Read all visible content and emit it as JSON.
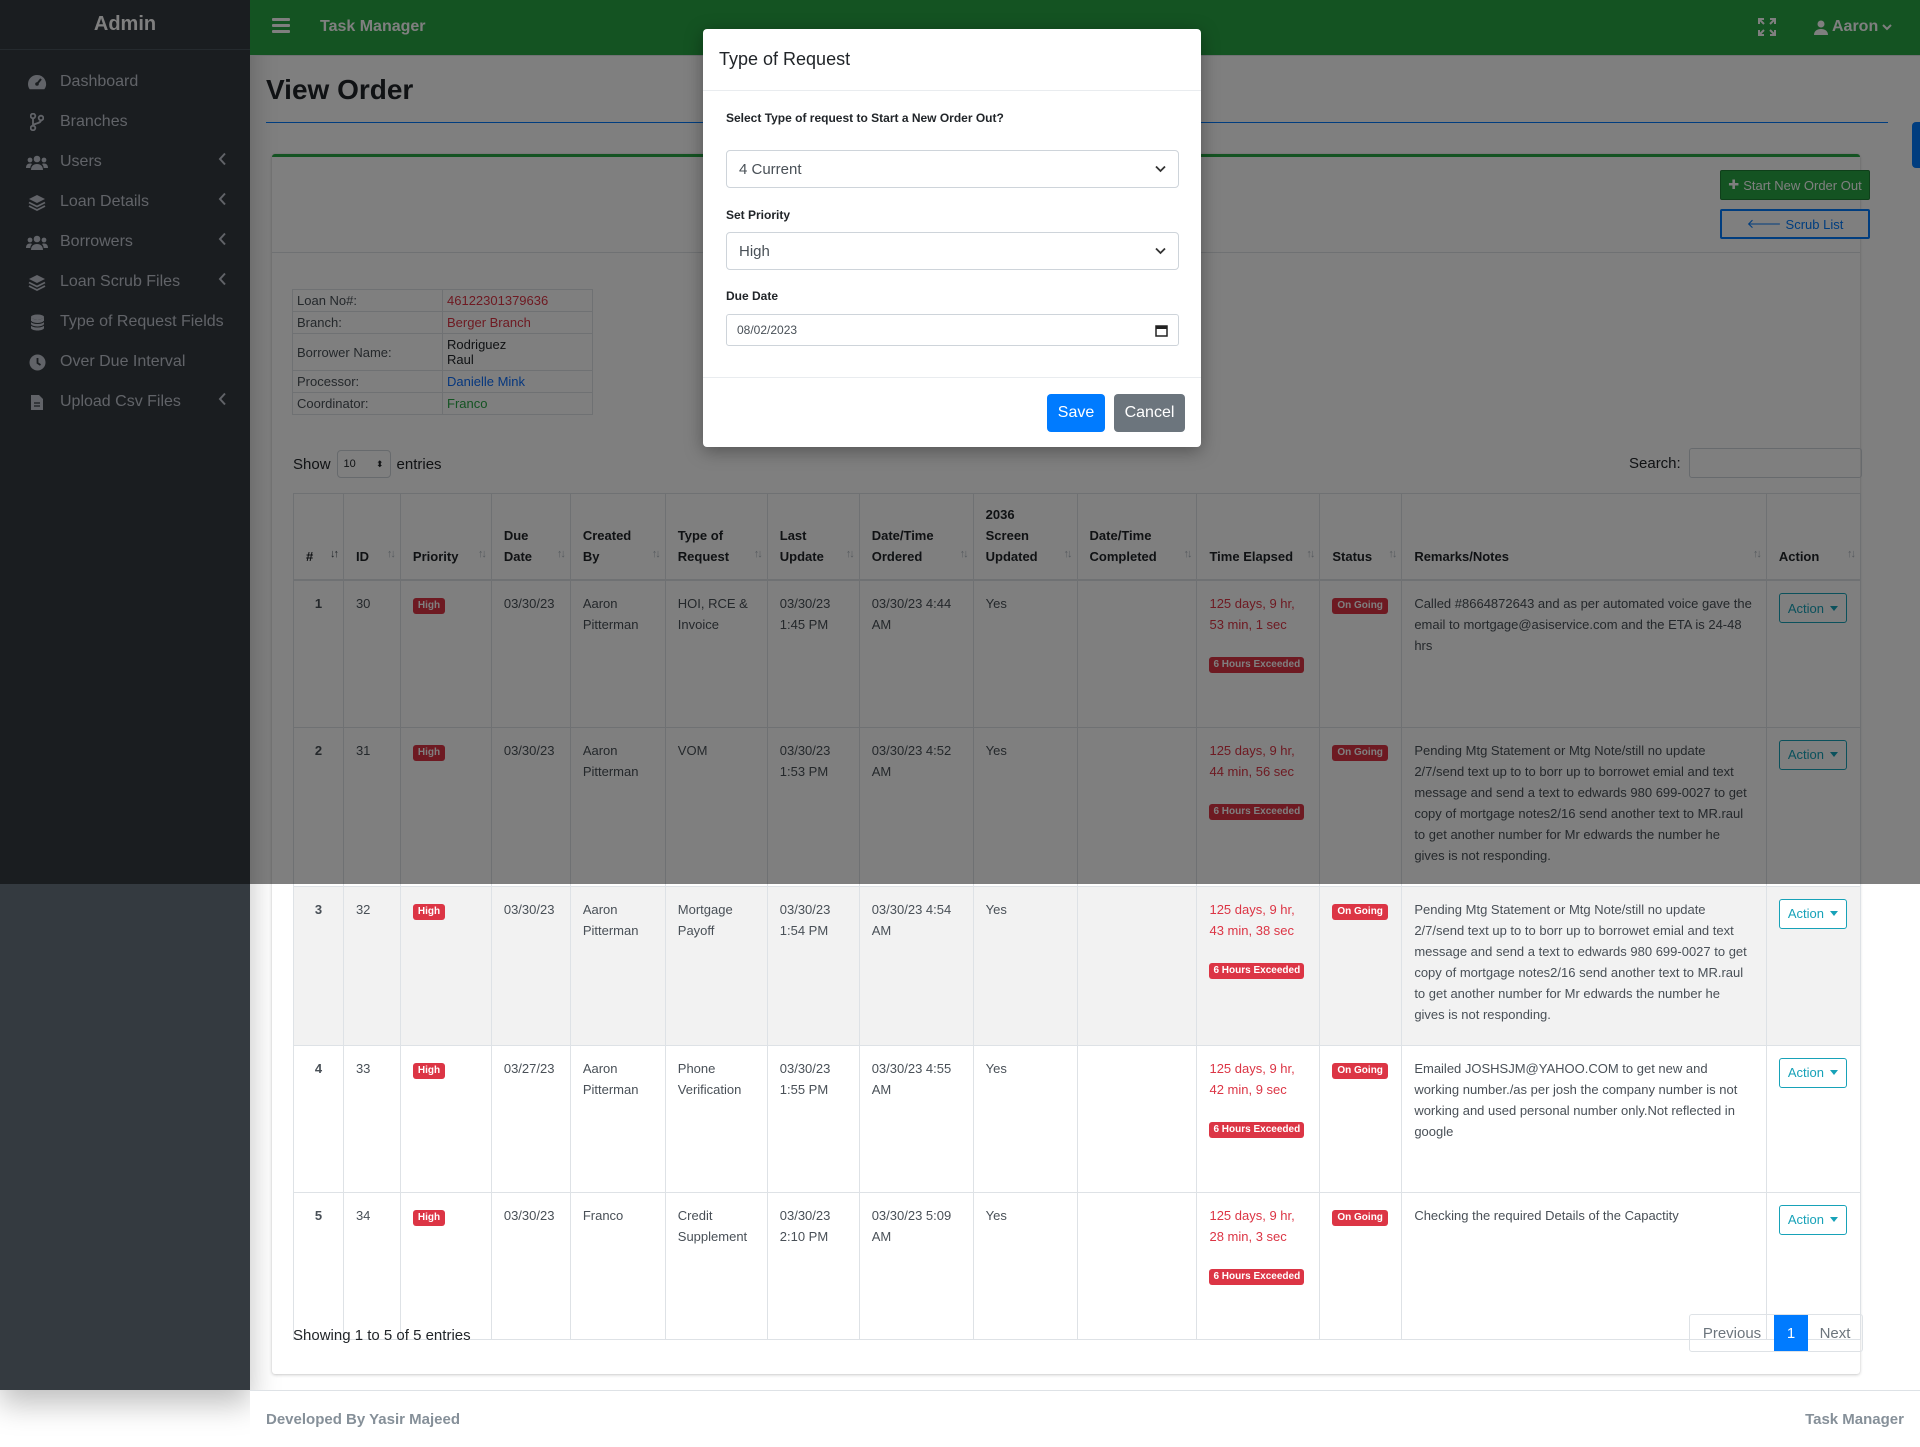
{
  "sidebar": {
    "brand": "Admin",
    "items": [
      {
        "label": "Dashboard",
        "icon": "tachometer-icon",
        "has_arrow": false
      },
      {
        "label": "Branches",
        "icon": "code-branch-icon",
        "has_arrow": false
      },
      {
        "label": "Users",
        "icon": "users-icon",
        "has_arrow": true
      },
      {
        "label": "Loan Details",
        "icon": "layers-icon",
        "has_arrow": true
      },
      {
        "label": "Borrowers",
        "icon": "users-icon",
        "has_arrow": true
      },
      {
        "label": "Loan Scrub Files",
        "icon": "layers-icon",
        "has_arrow": true
      },
      {
        "label": "Type of Request Fields",
        "icon": "database-icon",
        "has_arrow": false
      },
      {
        "label": "Over Due Interval",
        "icon": "clock-icon",
        "has_arrow": false
      },
      {
        "label": "Upload Csv Files",
        "icon": "file-icon",
        "has_arrow": true
      }
    ]
  },
  "topbar": {
    "title": "Task Manager",
    "user": "Aaron"
  },
  "page": {
    "title": "View Order"
  },
  "buttons": {
    "start_new": "Start New Order Out",
    "scrub_list": "Scrub List"
  },
  "info": {
    "loan_no_label": "Loan No#:",
    "loan_no": "46122301379636",
    "branch_label": "Branch:",
    "branch": "Berger Branch",
    "borrower_label": "Borrower Name:",
    "borrower_first": "Rodriguez",
    "borrower_last": "Raul",
    "processor_label": "Processor:",
    "processor": "Danielle Mink",
    "coordinator_label": "Coordinator:",
    "coordinator": "Franco"
  },
  "table_controls": {
    "show": "Show",
    "entries_value": "10",
    "entries": "entries",
    "search_label": "Search:"
  },
  "table": {
    "headers": [
      "#",
      "ID",
      "Priority",
      "Due Date",
      "Created By",
      "Type of Request",
      "Last Update",
      "Date/Time Ordered",
      "2036 Screen Updated",
      "Date/Time Completed",
      "Time Elapsed",
      "Status",
      "Remarks/Notes",
      "Action"
    ],
    "rows": [
      {
        "num": "1",
        "id": "30",
        "priority": "High",
        "due": "03/30/23",
        "created": "Aaron Pitterman",
        "type": "HOI, RCE & Invoice",
        "last_update": "03/30/23 1:45 PM",
        "ordered": "03/30/23 4:44 AM",
        "screen": "Yes",
        "completed": "",
        "elapsed": "125 days, 9 hr, 53 min, 1 sec",
        "exceeded": "6 Hours Exceeded",
        "status": "On Going",
        "remarks": "Called #8664872643 and as per automated voice gave the email to mortgage@asiservice.com and the ETA is 24-48 hrs",
        "action": "Action"
      },
      {
        "num": "2",
        "id": "31",
        "priority": "High",
        "due": "03/30/23",
        "created": "Aaron Pitterman",
        "type": "VOM",
        "last_update": "03/30/23 1:53 PM",
        "ordered": "03/30/23 4:52 AM",
        "screen": "Yes",
        "completed": "",
        "elapsed": "125 days, 9 hr, 44 min, 56 sec",
        "exceeded": "6 Hours Exceeded",
        "status": "On Going",
        "remarks": "Pending Mtg Statement or Mtg Note/still no update 2/7/send text  up to to borr up to borrowet emial and text message and send a text to edwards 980 699-0027 to get copy of mortgage notes2/16 send another text to MR.raul to get another number for Mr edwards the number he gives is not responding.",
        "action": "Action"
      },
      {
        "num": "3",
        "id": "32",
        "priority": "High",
        "due": "03/30/23",
        "created": "Aaron Pitterman",
        "type": "Mortgage Payoff",
        "last_update": "03/30/23 1:54 PM",
        "ordered": "03/30/23 4:54 AM",
        "screen": "Yes",
        "completed": "",
        "elapsed": "125 days, 9 hr, 43 min, 38 sec",
        "exceeded": "6 Hours Exceeded",
        "status": "On Going",
        "remarks": "Pending Mtg Statement or Mtg Note/still no update 2/7/send text  up to to borr up to borrowet emial and text message and send a text to edwards 980 699-0027 to get copy of mortgage notes2/16 send another text to MR.raul to get another number for Mr edwards the number he gives is not responding.",
        "action": "Action"
      },
      {
        "num": "4",
        "id": "33",
        "priority": "High",
        "due": "03/27/23",
        "created": "Aaron Pitterman",
        "type": "Phone Verification",
        "last_update": "03/30/23 1:55 PM",
        "ordered": "03/30/23 4:55 AM",
        "screen": "Yes",
        "completed": "",
        "elapsed": "125 days, 9 hr, 42 min, 9 sec",
        "exceeded": "6 Hours Exceeded",
        "status": "On Going",
        "remarks": "Emailed  JOSHSJM@YAHOO.COM  to get new and working number./as per josh the company number is not working and used personal number only.Not reflected in google",
        "action": "Action"
      },
      {
        "num": "5",
        "id": "34",
        "priority": "High",
        "due": "03/30/23",
        "created": "Franco",
        "type": "Credit Supplement",
        "last_update": "03/30/23 2:10 PM",
        "ordered": "03/30/23 5:09 AM",
        "screen": "Yes",
        "completed": "",
        "elapsed": "125 days, 9 hr, 28 min, 3 sec",
        "exceeded": "6 Hours Exceeded",
        "status": "On Going",
        "remarks": "Checking the required Details of the Capactity",
        "action": "Action"
      }
    ]
  },
  "pagination": {
    "showing": "Showing 1 to 5 of 5 entries",
    "previous": "Previous",
    "current": "1",
    "next": "Next"
  },
  "footer": {
    "left": "Developed By Yasir Majeed",
    "right": "Task Manager"
  },
  "modal": {
    "title": "Type of Request",
    "type_label": "Select Type of request to Start a New Order Out?",
    "type_value": "4 Current",
    "priority_label": "Set Priority",
    "priority_value": "High",
    "due_label": "Due Date",
    "due_value": "08/02/2023",
    "save": "Save",
    "cancel": "Cancel"
  },
  "colors": {
    "topbar": "#28a745",
    "sidebar": "#343a40",
    "primary": "#007bff",
    "danger": "#dc3545",
    "info": "#17a2b8"
  }
}
